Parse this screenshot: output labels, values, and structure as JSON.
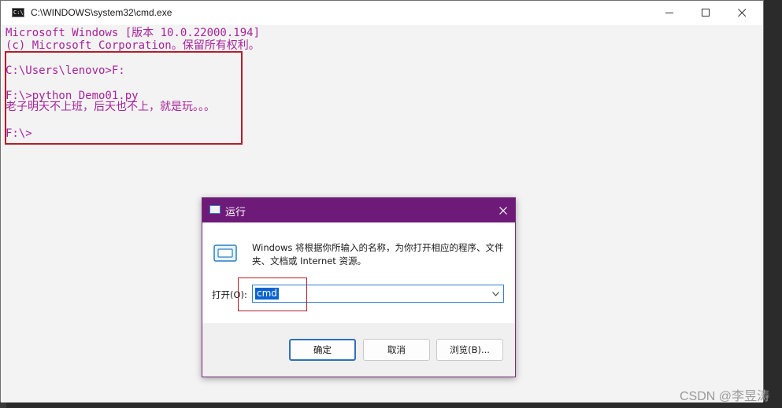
{
  "cmd": {
    "title": "C:\\WINDOWS\\system32\\cmd.exe",
    "icon": "cmd-icon",
    "console_lines": [
      "Microsoft Windows [版本 10.0.22000.194]",
      "(c) Microsoft Corporation。保留所有权利。",
      "",
      "C:\\Users\\lenovo>F:",
      "",
      "F:\\>python Demo01.py",
      "老子明天不上班，后天也不上，就是玩。。。",
      "",
      "F:\\>"
    ],
    "text_color": "#a8239b",
    "background": "#f3f3f3"
  },
  "run": {
    "title": "运行",
    "description": "Windows 将根据你所输入的名称，为你打开相应的程序、文件夹、文档或 Internet 资源。",
    "open_label": "打开(O):",
    "input_value": "cmd",
    "ok_label": "确定",
    "cancel_label": "取消",
    "browse_label": "浏览(B)...",
    "accent": "#6e1a78"
  },
  "watermark": "CSDN @李昱涛",
  "annotation_color": "#b71c2a"
}
